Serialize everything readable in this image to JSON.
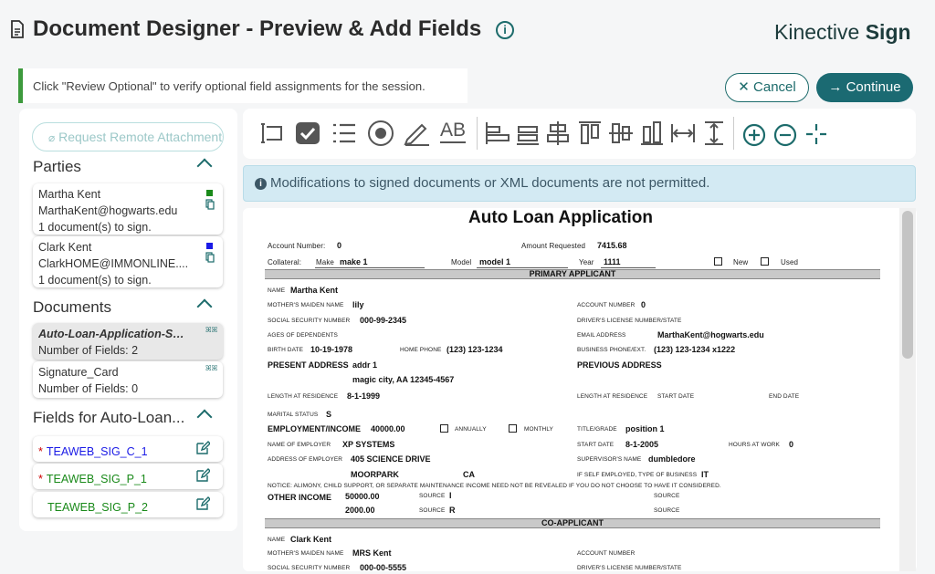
{
  "header": {
    "title": "Document Designer - Preview & Add Fields",
    "brand_light": "Kinective",
    "brand_bold": "Sign"
  },
  "notice": "Click \"Review Optional\" to verify optional field assignments for the session.",
  "actions": {
    "cancel": "Cancel",
    "continue": "Continue"
  },
  "left": {
    "remote_button": "Request Remote Attachments",
    "parties_title": "Parties",
    "parties": [
      {
        "name": "Martha Kent",
        "email": "MarthaKent@hogwarts.edu",
        "docs": "1 document(s) to sign.",
        "color": "#1a8a1a"
      },
      {
        "name": "Clark Kent",
        "email": "ClarkHOME@IMMONLINE....",
        "docs": "1 document(s) to sign.",
        "color": "#1a1ae6"
      }
    ],
    "documents_title": "Documents",
    "documents": [
      {
        "name": "Auto-Loan-Application-Sh...",
        "fields": "Number of Fields: 2"
      },
      {
        "name": "Signature_Card",
        "fields": "Number of Fields: 0"
      }
    ],
    "fields_title": "Fields for Auto-Loan...",
    "fields": [
      {
        "star": "*",
        "name": "TEAWEB_SIG_C_1",
        "color": "#1a1ae6"
      },
      {
        "star": "*",
        "name": "TEAWEB_SIG_P_1",
        "color": "#1a8a1a"
      },
      {
        "star": "",
        "name": "TEAWEB_SIG_P_2",
        "color": "#1a8a1a"
      }
    ]
  },
  "toolbar": {
    "tools": [
      "text-field-icon",
      "checkbox-icon",
      "list-icon",
      "radio-icon",
      "signature-icon",
      "text-label-icon",
      "align-left-icon",
      "align-bottom-icon",
      "align-center-icon",
      "align-top-icon",
      "align-middle-icon",
      "align-baseline-icon",
      "same-width-icon",
      "same-height-icon",
      "zoom-in-icon",
      "zoom-out-icon",
      "crosshair-icon"
    ],
    "ab_label": "AB"
  },
  "warning": "Modifications to signed documents or XML documents are not permitted.",
  "doc": {
    "title": "Auto Loan Application",
    "account_number_label": "Account Number:",
    "account_number": "0",
    "amount_requested_label": "Amount Requested",
    "amount_requested": "7415.68",
    "collateral_label": "Collateral:",
    "make_label": "Make",
    "make": "make 1",
    "model_label": "Model",
    "model": "model 1",
    "year_label": "Year",
    "year": "1111",
    "new_label": "New",
    "used_label": "Used",
    "primary_header": "PRIMARY APPLICANT",
    "name_label": "NAME",
    "name": "Martha Kent",
    "maiden_label": "MOTHER'S MAIDEN NAME",
    "maiden": "lily",
    "acct_label": "ACCOUNT NUMBER",
    "acct": "0",
    "ssn_label": "SOCIAL SECURITY NUMBER",
    "ssn": "000-99-2345",
    "dl_label": "DRIVER'S LICENSE NUMBER/STATE",
    "ages_label": "AGES OF DEPENDENTS",
    "email_label": "EMAIL ADDRESS",
    "email": "MarthaKent@hogwarts.edu",
    "birth_label": "BIRTH DATE",
    "birth": "10-19-1978",
    "homephone_label": "HOME PHONE",
    "homephone": "(123) 123-1234",
    "bizphone_label": "BUSINESS PHONE/EXT.",
    "bizphone": "(123) 123-1234 x1222",
    "present_addr_label": "PRESENT ADDRESS",
    "addr1": "addr 1",
    "addr2": "magic city, AA 12345-4567",
    "prev_addr_label": "PREVIOUS ADDRESS",
    "length_label": "LENGTH AT RESIDENCE",
    "length": "8-1-1999",
    "length2_label": "LENGTH AT RESIDENCE",
    "start_date_label": "START DATE",
    "end_date_label": "END DATE",
    "marital_label": "MARITAL STATUS",
    "marital": "S",
    "employment_label": "EMPLOYMENT/INCOME",
    "income": "40000.00",
    "annually_label": "ANNUALLY",
    "monthly_label": "MONTHLY",
    "title_label": "TITLE/GRADE",
    "title_value": "position 1",
    "employer_label": "NAME OF EMPLOYER",
    "employer": "XP SYSTEMS",
    "emp_start_label": "START DATE",
    "emp_start": "8-1-2005",
    "hours_label": "HOURS AT WORK",
    "hours": "0",
    "emp_addr_label": "ADDRESS OF EMPLOYER",
    "emp_addr": "405 SCIENCE DRIVE",
    "supervisor_label": "SUPERVISOR'S NAME",
    "supervisor": "dumbledore",
    "emp_city": "MOORPARK",
    "emp_state": "CA",
    "selfemp_label": "IF SELF EMPLOYED, TYPE OF BUSINESS",
    "selfemp": "IT",
    "alimony_note": "NOTICE: ALIMONY, CHILD SUPPORT, OR SEPARATE MAINTENANCE INCOME NEED NOT BE REVEALED IF YOU DO NOT CHOOSE TO HAVE IT CONSIDERED.",
    "other_income_label": "OTHER INCOME",
    "other_income1": "50000.00",
    "other_income2": "2000.00",
    "source_label": "SOURCE",
    "source1": "I",
    "source2": "R",
    "source_r_label": "SOURCE",
    "co_header": "CO-APPLICANT",
    "co_name_label": "NAME",
    "co_name": "Clark Kent",
    "co_maiden_label": "MOTHER'S MAIDEN NAME",
    "co_maiden": "MRS Kent",
    "co_acct_label": "ACCOUNT NUMBER",
    "co_ssn_label": "SOCIAL SECURITY NUMBER",
    "co_ssn": "000-00-5555",
    "co_dl_label": "DRIVER'S LICENSE NUMBER/STATE"
  }
}
